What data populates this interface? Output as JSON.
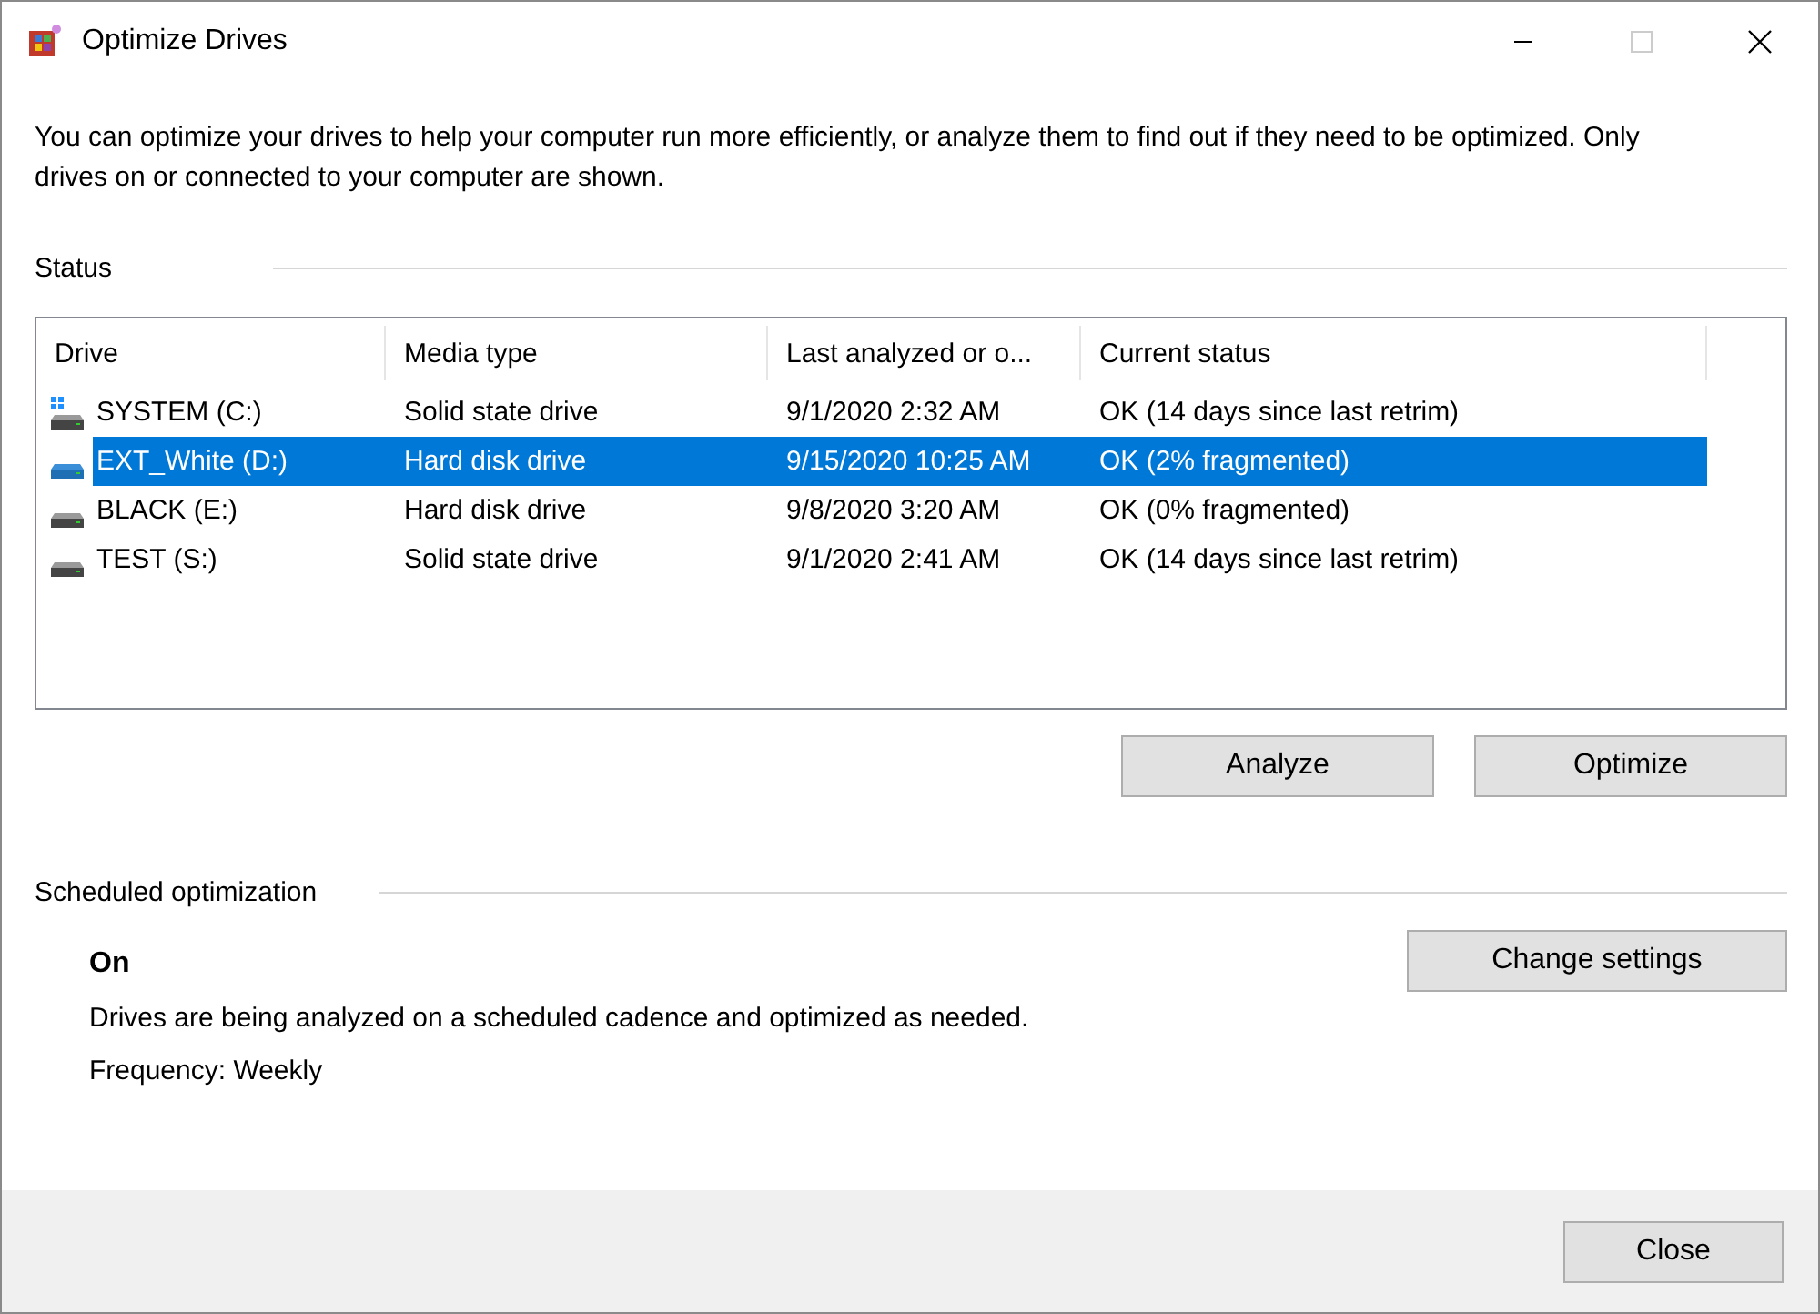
{
  "window": {
    "title": "Optimize Drives",
    "maximize_enabled": false
  },
  "intro": "You can optimize your drives to help your computer run more efficiently, or analyze them to find out if they need to be optimized. Only drives on or connected to your computer are shown.",
  "status": {
    "heading": "Status",
    "columns": [
      "Drive",
      "Media type",
      "Last analyzed or o...",
      "Current status"
    ],
    "rows": [
      {
        "drive": "SYSTEM (C:)",
        "system": true,
        "media_type": "Solid state drive",
        "last_analyzed": "9/1/2020 2:32 AM",
        "current_status": "OK (14 days since last retrim)",
        "selected": false
      },
      {
        "drive": "EXT_White (D:)",
        "system": false,
        "media_type": "Hard disk drive",
        "last_analyzed": "9/15/2020 10:25 AM",
        "current_status": "OK (2% fragmented)",
        "selected": true
      },
      {
        "drive": "BLACK (E:)",
        "system": false,
        "media_type": "Hard disk drive",
        "last_analyzed": "9/8/2020 3:20 AM",
        "current_status": "OK (0% fragmented)",
        "selected": false
      },
      {
        "drive": "TEST (S:)",
        "system": false,
        "media_type": "Solid state drive",
        "last_analyzed": "9/1/2020 2:41 AM",
        "current_status": "OK (14 days since last retrim)",
        "selected": false
      }
    ],
    "buttons": [
      "Analyze",
      "Optimize"
    ]
  },
  "scheduled": {
    "heading": "Scheduled optimization",
    "state": "On",
    "description": "Drives are being analyzed on a scheduled cadence and optimized as needed.",
    "frequency": "Frequency: Weekly",
    "button": "Change settings"
  },
  "footer": {
    "button": "Close"
  }
}
